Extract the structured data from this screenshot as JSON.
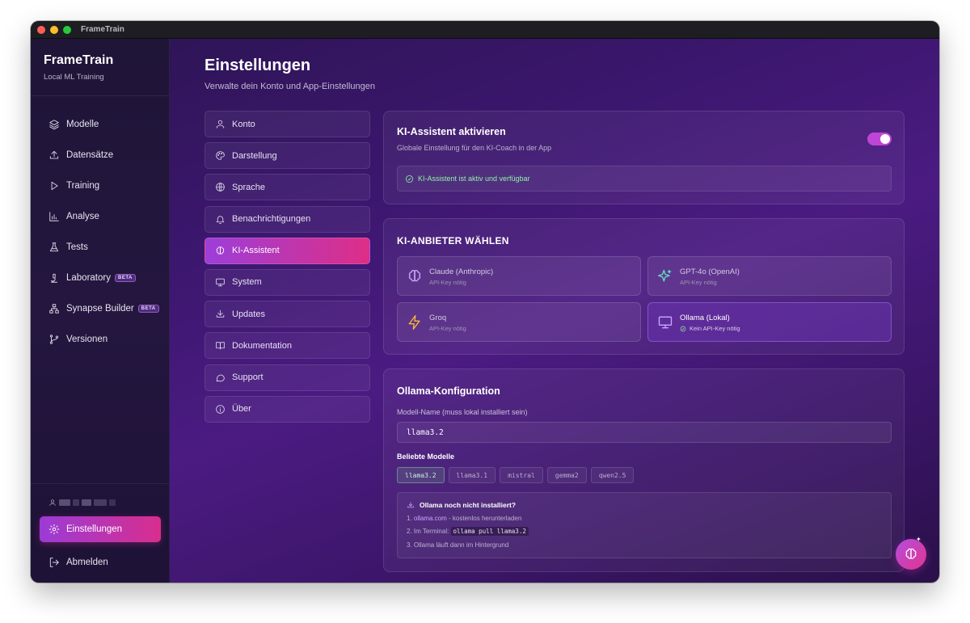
{
  "window": {
    "title": "FrameTrain"
  },
  "sidebar": {
    "brand": "FrameTrain",
    "subtitle": "Local ML Training",
    "items": [
      {
        "label": "Modelle",
        "icon": "layers-icon"
      },
      {
        "label": "Datensätze",
        "icon": "upload-icon"
      },
      {
        "label": "Training",
        "icon": "play-icon"
      },
      {
        "label": "Analyse",
        "icon": "bar-chart-icon"
      },
      {
        "label": "Tests",
        "icon": "flask-icon"
      },
      {
        "label": "Laboratory",
        "icon": "microscope-icon",
        "badge": "BETA"
      },
      {
        "label": "Synapse Builder",
        "icon": "network-icon",
        "badge": "BETA"
      },
      {
        "label": "Versionen",
        "icon": "git-branch-icon"
      }
    ],
    "settings_label": "Einstellungen",
    "logout_label": "Abmelden"
  },
  "page": {
    "title": "Einstellungen",
    "subtitle": "Verwalte dein Konto und App-Einstellungen"
  },
  "settings_menu": [
    {
      "label": "Konto",
      "icon": "user-icon"
    },
    {
      "label": "Darstellung",
      "icon": "palette-icon"
    },
    {
      "label": "Sprache",
      "icon": "globe-icon"
    },
    {
      "label": "Benachrichtigungen",
      "icon": "bell-icon"
    },
    {
      "label": "KI-Assistent",
      "icon": "brain-icon",
      "active": true
    },
    {
      "label": "System",
      "icon": "monitor-icon"
    },
    {
      "label": "Updates",
      "icon": "download-icon"
    },
    {
      "label": "Dokumentation",
      "icon": "book-icon"
    },
    {
      "label": "Support",
      "icon": "chat-icon"
    },
    {
      "label": "Über",
      "icon": "info-icon"
    }
  ],
  "assistant": {
    "title": "KI-Assistent aktivieren",
    "subtitle": "Globale Einstellung für den KI-Coach in der App",
    "enabled": true,
    "status": "KI-Assistent ist aktiv und verfügbar"
  },
  "providers": {
    "title": "KI-ANBIETER WÄHLEN",
    "items": [
      {
        "name": "Claude (Anthropic)",
        "note": "API-Key nötig",
        "icon": "brain-icon",
        "color": "#c9a8ff"
      },
      {
        "name": "GPT-4o (OpenAI)",
        "note": "API-Key nötig",
        "icon": "sparkle-icon",
        "color": "#5fe0c0"
      },
      {
        "name": "Groq",
        "note": "API-Key nötig",
        "icon": "lightning-icon",
        "color": "#f5b93a"
      },
      {
        "name": "Ollama (Lokal)",
        "note": "Kein API-Key nötig",
        "icon": "monitor-icon",
        "color": "#c9a8ff",
        "selected": true
      }
    ]
  },
  "ollama": {
    "title": "Ollama-Konfiguration",
    "model_label": "Modell-Name (muss lokal installiert sein)",
    "model_value": "llama3.2",
    "popular_label": "Beliebte Modelle",
    "models": [
      "llama3.2",
      "llama3.1",
      "mistral",
      "gemma2",
      "qwen2.5"
    ],
    "help_title": "Ollama noch nicht installiert?",
    "help_1_prefix": "1. ",
    "help_1_link": "ollama.com",
    "help_1_rest": " - kostenlos herunterladen",
    "help_2_prefix": "2. Im Terminal: ",
    "help_2_code": "ollama pull llama3.2",
    "help_3": "3. Ollama läuft dann im Hintergrund"
  },
  "colors": {
    "accent_start": "#9b3bd6",
    "accent_end": "#d82e8e",
    "success": "#8ff0a4"
  }
}
